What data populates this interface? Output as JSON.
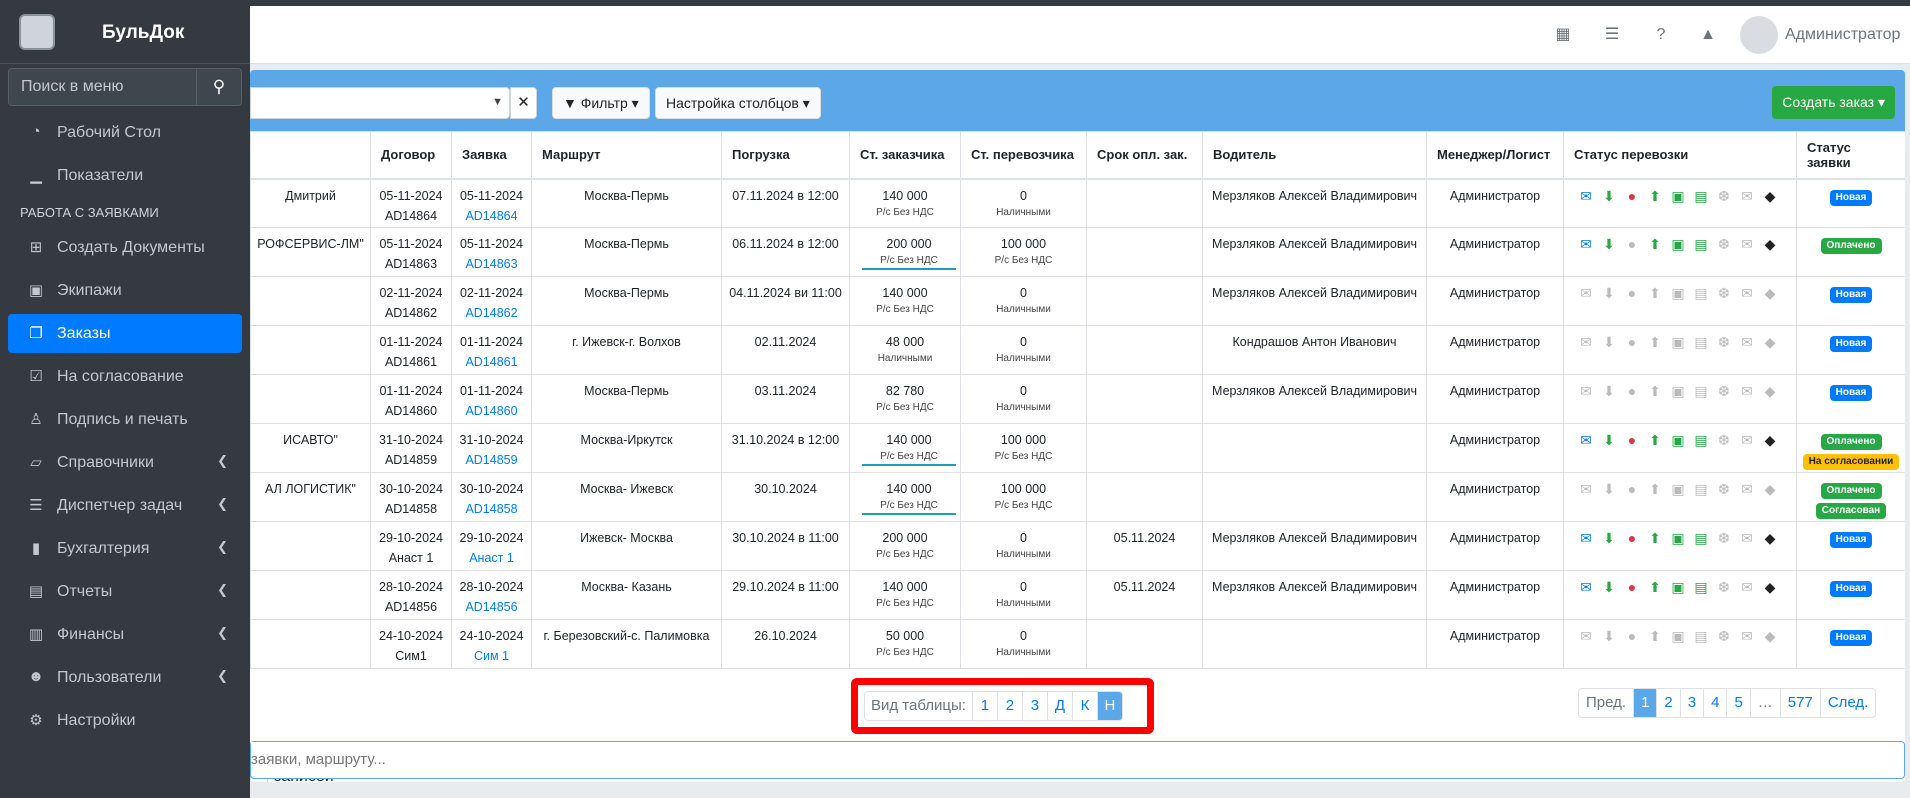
{
  "brand": {
    "name": "БульДок"
  },
  "sidebar": {
    "search_placeholder": "Поиск в меню",
    "items": [
      {
        "label": "Рабочий Стол",
        "icon": "dashboard-icon"
      },
      {
        "label": "Показатели",
        "icon": "chart-icon"
      }
    ],
    "section_header": "РАБОТА С ЗАЯВКАМИ",
    "items2": [
      {
        "label": "Создать Документы",
        "icon": "plus-square-icon"
      },
      {
        "label": "Экипажи",
        "icon": "id-card-icon"
      },
      {
        "label": "Заказы",
        "icon": "copy-icon",
        "active": true
      },
      {
        "label": "На согласование",
        "icon": "clipboard-check-icon"
      },
      {
        "label": "Подпись и печать",
        "icon": "stamp-icon"
      },
      {
        "label": "Справочники",
        "icon": "folder-open-icon"
      },
      {
        "label": "Диспетчер задач",
        "icon": "tasks-icon"
      },
      {
        "label": "Бухгалтерия",
        "icon": "book-icon"
      },
      {
        "label": "Отчеты",
        "icon": "report-icon"
      },
      {
        "label": "Финансы",
        "icon": "money-icon"
      },
      {
        "label": "Пользователи",
        "icon": "users-icon"
      },
      {
        "label": "Настройки",
        "icon": "gear-icon"
      }
    ]
  },
  "navbar": {
    "user": "Администратор"
  },
  "toolbar": {
    "filter": "Фильтр",
    "columns": "Настройка столбцов",
    "create": "Создать заказ"
  },
  "table": {
    "headers": [
      "Договор",
      "Заявка",
      "Маршрут",
      "Погрузка",
      "Ст. заказчика",
      "Ст. перевозчика",
      "Срок опл. зак.",
      "Водитель",
      "Менеджер/Логист",
      "Статус перевозки",
      "Статус заявки"
    ],
    "rows": [
      {
        "client": "Дмитрий",
        "dog_date": "05-11-2024",
        "dog_no": "AD14864",
        "z_date": "05-11-2024",
        "z_no": "AD14864",
        "route": "Москва-Пермь",
        "load": "07.11.2024 в 12:00",
        "c_sum": "140 000",
        "c_note": "Р/с Без НДС",
        "c_ul": false,
        "p_sum": "0",
        "p_note": "Наличными",
        "term": "",
        "driver": "Мерзляков Алексей Владимирович",
        "manager": "Администратор",
        "badges": [
          {
            "t": "Новая",
            "k": "new"
          }
        ]
      },
      {
        "client": "РОФСЕРВИС-ЛМ\"",
        "dog_date": "05-11-2024",
        "dog_no": "AD14863",
        "z_date": "05-11-2024",
        "z_no": "AD14863",
        "route": "Москва-Пермь",
        "load": "06.11.2024 в 12:00",
        "c_sum": "200 000",
        "c_note": "Р/с Без НДС",
        "c_ul": true,
        "p_sum": "100 000",
        "p_note": "Р/с Без НДС",
        "term": "",
        "driver": "Мерзляков Алексей Владимирович",
        "manager": "Администратор",
        "badges": [
          {
            "t": "Оплачено",
            "k": "paid"
          }
        ]
      },
      {
        "client": "",
        "dog_date": "02-11-2024",
        "dog_no": "AD14862",
        "z_date": "02-11-2024",
        "z_no": "AD14862",
        "route": "Москва-Пермь",
        "load": "04.11.2024 ви 11:00",
        "c_sum": "140 000",
        "c_note": "Р/с Без НДС",
        "c_ul": false,
        "p_sum": "0",
        "p_note": "Наличными",
        "term": "",
        "driver": "Мерзляков Алексей Владимирович",
        "manager": "Администратор",
        "badges": [
          {
            "t": "Новая",
            "k": "new"
          }
        ]
      },
      {
        "client": "",
        "dog_date": "01-11-2024",
        "dog_no": "AD14861",
        "z_date": "01-11-2024",
        "z_no": "AD14861",
        "route": "г. Ижевск-г. Волхов",
        "load": "02.11.2024",
        "c_sum": "48 000",
        "c_note": "Наличными",
        "c_ul": false,
        "p_sum": "0",
        "p_note": "Наличными",
        "term": "",
        "driver": "Кондрашов Антон Иванович",
        "manager": "Администратор",
        "badges": [
          {
            "t": "Новая",
            "k": "new"
          }
        ]
      },
      {
        "client": "",
        "dog_date": "01-11-2024",
        "dog_no": "AD14860",
        "z_date": "01-11-2024",
        "z_no": "AD14860",
        "route": "Москва-Пермь",
        "load": "03.11.2024",
        "c_sum": "82 780",
        "c_note": "Р/с Без НДС",
        "c_ul": false,
        "p_sum": "0",
        "p_note": "Наличными",
        "term": "",
        "driver": "Мерзляков Алексей Владимирович",
        "manager": "Администратор",
        "badges": [
          {
            "t": "Новая",
            "k": "new"
          }
        ]
      },
      {
        "client": "ИСАВТО\"",
        "dog_date": "31-10-2024",
        "dog_no": "AD14859",
        "z_date": "31-10-2024",
        "z_no": "AD14859",
        "route": "Москва-Иркутск",
        "load": "31.10.2024 в 12:00",
        "c_sum": "140 000",
        "c_note": "Р/с Без НДС",
        "c_ul": true,
        "p_sum": "100 000",
        "p_note": "Р/с Без НДС",
        "term": "",
        "driver": "",
        "manager": "Администратор",
        "badges": [
          {
            "t": "Оплачено",
            "k": "paid"
          },
          {
            "t": "На согласовании",
            "k": "agree"
          }
        ]
      },
      {
        "client": "АЛ ЛОГИСТИК\"",
        "dog_date": "30-10-2024",
        "dog_no": "AD14858",
        "z_date": "30-10-2024",
        "z_no": "AD14858",
        "route": "Москва- Ижевск",
        "load": "30.10.2024",
        "c_sum": "140 000",
        "c_note": "Р/с Без НДС",
        "c_ul": true,
        "p_sum": "100 000",
        "p_note": "Р/с Без НДС",
        "term": "",
        "driver": "",
        "manager": "Администратор",
        "badges": [
          {
            "t": "Оплачено",
            "k": "paid"
          },
          {
            "t": "Согласован",
            "k": "paid"
          }
        ]
      },
      {
        "client": "",
        "dog_date": "29-10-2024",
        "dog_no": "Анаст 1",
        "z_date": "29-10-2024",
        "z_no": "Анаст 1",
        "route": "Ижевск- Москва",
        "load": "30.10.2024 в 11:00",
        "c_sum": "200 000",
        "c_note": "Р/с Без НДС",
        "c_ul": false,
        "p_sum": "0",
        "p_note": "Наличными",
        "term": "05.11.2024",
        "driver": "Мерзляков Алексей Владимирович",
        "manager": "Администратор",
        "badges": [
          {
            "t": "Новая",
            "k": "new"
          }
        ]
      },
      {
        "client": "",
        "dog_date": "28-10-2024",
        "dog_no": "AD14856",
        "z_date": "28-10-2024",
        "z_no": "AD14856",
        "route": "Москва- Казань",
        "load": "29.10.2024 в 11:00",
        "c_sum": "140 000",
        "c_note": "Р/с Без НДС",
        "c_ul": false,
        "p_sum": "0",
        "p_note": "Наличными",
        "term": "05.11.2024",
        "driver": "Мерзляков Алексей Владимирович",
        "manager": "Администратор",
        "badges": [
          {
            "t": "Новая",
            "k": "new"
          }
        ]
      },
      {
        "client": "",
        "dog_date": "24-10-2024",
        "dog_no": "Сим1",
        "z_date": "24-10-2024",
        "z_no": "Сим 1",
        "route": "г. Березовский-с. Палимовка",
        "load": "26.10.2024",
        "c_sum": "50 000",
        "c_note": "Р/с Без НДС",
        "c_ul": false,
        "p_sum": "0",
        "p_note": "Наличными",
        "term": "",
        "driver": "",
        "manager": "Администратор",
        "badges": [
          {
            "t": "Новая",
            "k": "new"
          }
        ]
      }
    ]
  },
  "footer": {
    "records_label": "записей",
    "view_label": "Вид таблицы:",
    "view_options": [
      "1",
      "2",
      "3",
      "Д",
      "К",
      "Н"
    ],
    "view_active": "Н",
    "pager": [
      "Пред.",
      "1",
      "2",
      "3",
      "4",
      "5",
      "…",
      "577",
      "След."
    ],
    "pager_active": "1",
    "search_placeholder": "заявки, маршруту..."
  }
}
